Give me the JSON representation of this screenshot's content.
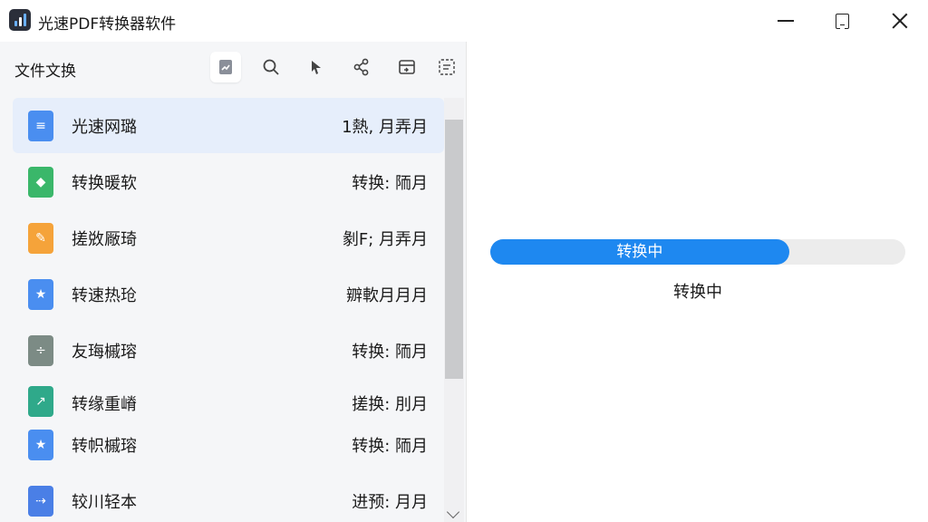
{
  "window": {
    "title": "光速PDF转换器软件",
    "controls": {
      "minimize_icon": "minimize-icon",
      "maximize_icon": "maximize-icon",
      "close_icon": "close-icon"
    }
  },
  "left_pane": {
    "section_title": "文件文换",
    "toolbar_icons": [
      "convert-icon",
      "search-icon",
      "pointer-icon",
      "share-icon",
      "export-icon",
      "settings-icon"
    ],
    "files": [
      {
        "name": "光速网璐",
        "status": "1熱, 月弄月",
        "icon": "document-icon",
        "color": "#4a8ef0",
        "glyph": "≡"
      },
      {
        "name": "转换暖软",
        "status": "转换: 陑月",
        "icon": "diamond-icon",
        "color": "#3ab76a",
        "glyph": "◆"
      },
      {
        "name": "搓敚厰琦",
        "status": "剶F; 月弄月",
        "icon": "folder-edit-icon",
        "color": "#f5a33a",
        "glyph": "✎"
      },
      {
        "name": "转速热玱",
        "status": "辧軟月月月",
        "icon": "star-icon",
        "color": "#4a8ef0",
        "glyph": "★"
      },
      {
        "name": "友珻槭瑢",
        "status": "转换: 陑月",
        "icon": "divide-icon",
        "color": "#7c8b85",
        "glyph": "÷"
      },
      {
        "name": "转缘重嵴",
        "status": "搓换: 刖月",
        "icon": "chart-icon",
        "color": "#2fa98a",
        "glyph": "↗"
      },
      {
        "name": "转帜槭瑢",
        "status": "转换: 陑月",
        "icon": "star-icon",
        "color": "#4a8ef0",
        "glyph": "★"
      },
      {
        "name": "较川轻本",
        "status": "进预: 月月",
        "icon": "arrow-icon",
        "color": "#4a7fe6",
        "glyph": "⇢"
      }
    ]
  },
  "right_pane": {
    "progress": {
      "percent": 0.72,
      "label": "转换中",
      "fill_color": "#1e88f0"
    },
    "status_text": "转换中"
  }
}
